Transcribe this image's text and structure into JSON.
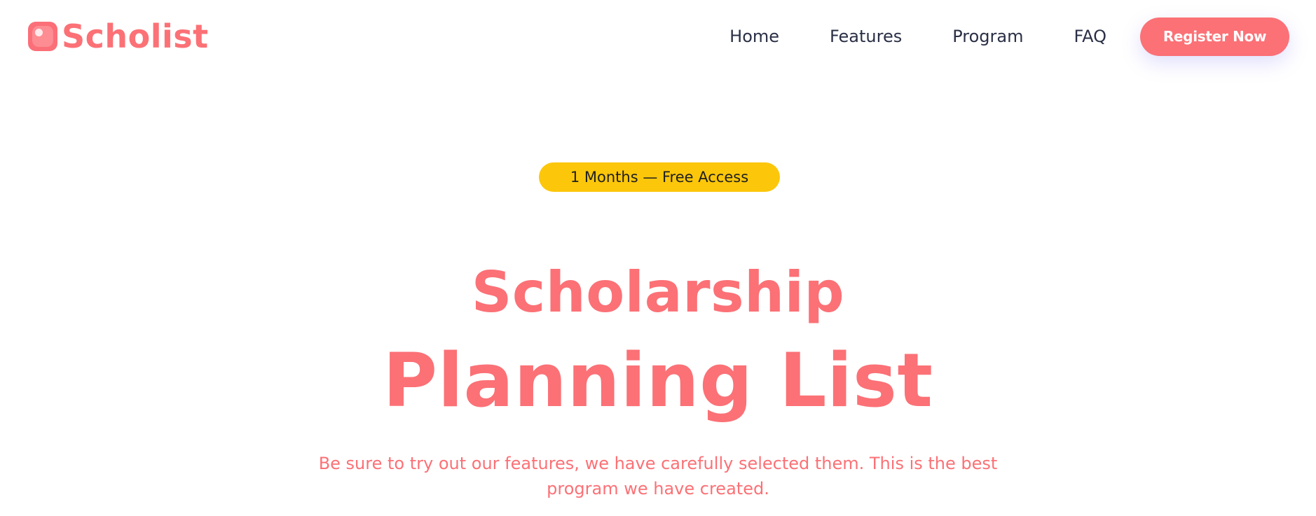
{
  "header": {
    "logo_text": "Scholist",
    "nav": {
      "home": "Home",
      "features": "Features",
      "program": "Program",
      "faq": "FAQ"
    },
    "register_label": "Register Now"
  },
  "hero": {
    "badge": "1 Months — Free Access",
    "title_line1": "Scholarship",
    "title_line2": "Planning List",
    "subtitle": "Be sure to try out our features, we have carefully selected them. This is the best program we have created."
  },
  "colors": {
    "brand": "#fb7176",
    "badge": "#fcc70b",
    "nav_text": "#2a2f45",
    "background": "#ffffff"
  },
  "icons": {
    "logo": "scholist-logo-icon"
  }
}
